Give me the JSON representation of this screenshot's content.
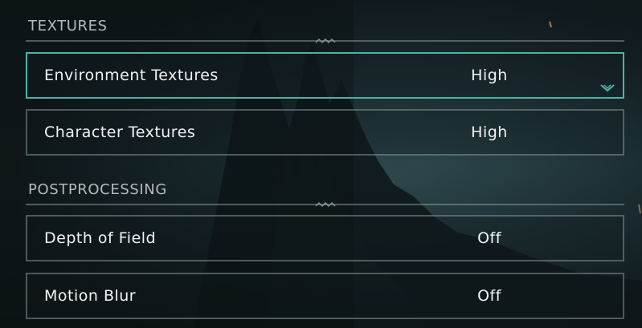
{
  "sections": [
    {
      "header": "TEXTURES",
      "settings": [
        {
          "label": "Environment Textures",
          "value": "High",
          "selected": true
        },
        {
          "label": "Character Textures",
          "value": "High",
          "selected": false
        }
      ]
    },
    {
      "header": "POSTPROCESSING",
      "settings": [
        {
          "label": "Depth of Field",
          "value": "Off",
          "selected": false
        },
        {
          "label": "Motion Blur",
          "value": "Off",
          "selected": false
        }
      ]
    }
  ],
  "colors": {
    "accent": "#4fb3a5",
    "row_border": "#a0aaae",
    "header_text": "#b4bbbe",
    "text": "#f2f4f4",
    "background": "#17242a"
  },
  "icons": {
    "selected_indicator": "chevron-down-icon",
    "section_divider": "wave-ornament-icon"
  }
}
